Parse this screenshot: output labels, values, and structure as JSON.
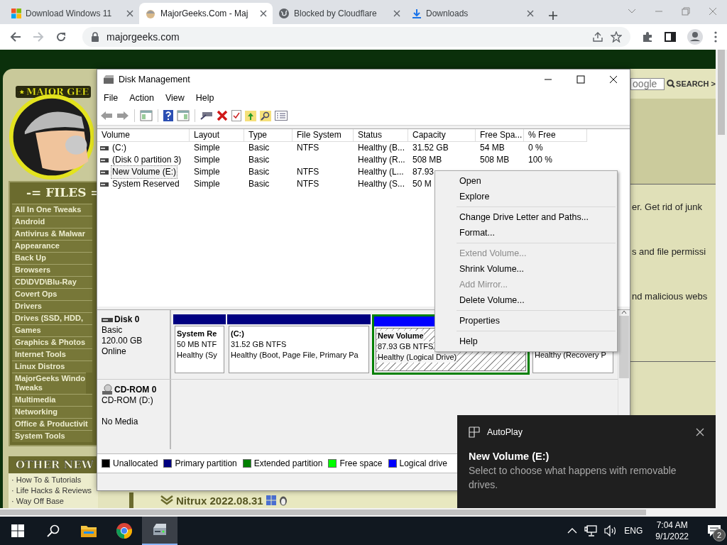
{
  "browser": {
    "tabs": [
      {
        "title": "Download Windows 11",
        "kind": "windows",
        "selected": false
      },
      {
        "title": "MajorGeeks.Com - Maj",
        "kind": "geek",
        "selected": true
      },
      {
        "title": "Blocked by Cloudflare",
        "kind": "globe",
        "selected": false
      },
      {
        "title": "Downloads",
        "kind": "download",
        "selected": false
      }
    ],
    "address": "majorgeeks.com"
  },
  "website": {
    "logo_text": "★MAJOR GEE",
    "files_heading": "-= FILES =",
    "categories": [
      "All In One Tweaks",
      "Android",
      "Antivirus & Malwar",
      "Appearance",
      "Back Up",
      "Browsers",
      "CD\\DVD\\Blu-Ray",
      "Covert Ops",
      "Drivers",
      "Drives (SSD, HDD,",
      "Games",
      "Graphics & Photos",
      "Internet Tools",
      "Linux Distros",
      "MajorGeeks Windo Tweaks",
      "Multimedia",
      "Networking",
      "Office & Productivit",
      "System Tools"
    ],
    "other_heading": "OTHER NEW",
    "other_links": [
      "· How To & Tutorials",
      "· Life Hacks & Reviews",
      "· Way Off Base"
    ],
    "search": {
      "placeholder": "oogle",
      "button": "SEARCH >"
    },
    "snippets": [
      "er. Get rid of junk",
      "s and file permissi",
      "nd malicious webs"
    ],
    "headline": "Nitrux 2022.08.31"
  },
  "disk_management": {
    "title": "Disk Management",
    "menu": [
      "File",
      "Action",
      "View",
      "Help"
    ],
    "columns": [
      "Volume",
      "Layout",
      "Type",
      "File System",
      "Status",
      "Capacity",
      "Free Spa...",
      "% Free"
    ],
    "volumes": [
      {
        "cells": [
          "(C:)",
          "Simple",
          "Basic",
          "NTFS",
          "Healthy (B...",
          "31.52 GB",
          "54 MB",
          "0 %"
        ],
        "selected": false
      },
      {
        "cells": [
          "(Disk 0 partition 3)",
          "Simple",
          "Basic",
          null,
          "Healthy (R...",
          "508 MB",
          "508 MB",
          "100 %"
        ],
        "selected": false
      },
      {
        "cells": [
          "New Volume (E:)",
          "Simple",
          "Basic",
          "NTFS",
          "Healthy (L...",
          "87.93"
        ],
        "selected": true
      },
      {
        "cells": [
          "System Reserved",
          "Simple",
          "Basic",
          "NTFS",
          "Healthy (S...",
          "50 M"
        ],
        "selected": false
      }
    ],
    "disks": [
      {
        "name": "Disk 0",
        "kind": "disk",
        "lines": [
          "Basic",
          "120.00 GB",
          "Online"
        ],
        "partitions": [
          {
            "label": "System Re",
            "lines": [
              "50 MB NTF",
              "Healthy (Sy"
            ],
            "kind": "primary",
            "color": "#000080",
            "selected": false
          },
          {
            "label": "(C:)",
            "lines": [
              "31.52 GB NTFS",
              "Healthy (Boot, Page File, Primary Pa"
            ],
            "kind": "primary",
            "color": "#000080",
            "selected": false
          },
          {
            "label": "New Volume",
            "lines": [
              "87.93 GB NTFS",
              "Healthy (Logical Drive)"
            ],
            "kind": "logical",
            "color": "#0000ff",
            "selected": true
          },
          {
            "lines": [
              "Healthy (Recovery P"
            ],
            "kind": "primary",
            "selected": false
          }
        ]
      },
      {
        "name": "CD-ROM 0",
        "kind": "cdrom",
        "lines": [
          "CD-ROM (D:)"
        ],
        "note": "No Media"
      }
    ],
    "legend": [
      {
        "label": "Unallocated",
        "color": "#000000"
      },
      {
        "label": "Primary partition",
        "color": "#000080"
      },
      {
        "label": "Extended partition",
        "color": "#008000"
      },
      {
        "label": "Free space",
        "color": "#00ff00"
      },
      {
        "label": "Logical drive",
        "color": "#0000ff"
      }
    ]
  },
  "context_menu": {
    "groups": [
      [
        {
          "label": "Open",
          "disabled": false
        },
        {
          "label": "Explore",
          "disabled": false
        }
      ],
      [
        {
          "label": "Change Drive Letter and Paths...",
          "disabled": false
        },
        {
          "label": "Format...",
          "disabled": false
        }
      ],
      [
        {
          "label": "Extend Volume...",
          "disabled": true
        },
        {
          "label": "Shrink Volume...",
          "disabled": false
        },
        {
          "label": "Add Mirror...",
          "disabled": true
        },
        {
          "label": "Delete Volume...",
          "disabled": false
        }
      ],
      [
        {
          "label": "Properties",
          "disabled": false
        }
      ],
      [
        {
          "label": "Help",
          "disabled": false
        }
      ]
    ]
  },
  "notification": {
    "app": "AutoPlay",
    "title": "New Volume (E:)",
    "body": "Select to choose what happens with removable drives."
  },
  "taskbar": {
    "apps": [
      {
        "kind": "explorer",
        "active": false
      },
      {
        "kind": "chrome",
        "active": false
      },
      {
        "kind": "disk",
        "active": true
      }
    ],
    "language": "ENG",
    "time": "7:04 AM",
    "date": "9/1/2022",
    "notifications": "2"
  }
}
